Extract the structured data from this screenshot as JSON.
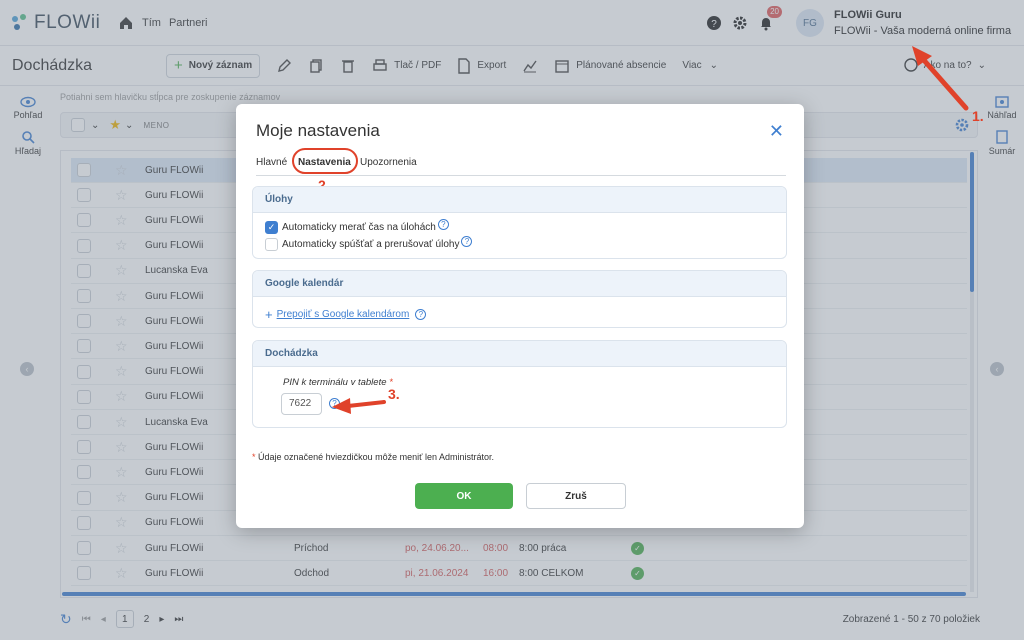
{
  "app": {
    "logo_text": "FLOWii",
    "nav": [
      "Tím",
      "Partneri"
    ],
    "notification_count": "20",
    "avatar_initials": "FG",
    "user_name": "FLOWii Guru",
    "user_firm": "FLOWii - Vaša moderná online firma"
  },
  "toolbar": {
    "title": "Dochádzka",
    "new_record": "Nový záznam",
    "print_pdf": "Tlač / PDF",
    "export": "Export",
    "planned_absences": "Plánované absencie",
    "more": "Viac",
    "how_to": "Ako na to?"
  },
  "side_left": {
    "view": "Pohľad",
    "search": "Hľadaj"
  },
  "side_right": {
    "preview": "Náhľad",
    "summary": "Sumár"
  },
  "grid": {
    "group_hint": "Potiahni sem hlavičku stĺpca pre zoskupenie záznamov",
    "name_header": "MENO",
    "rows": [
      {
        "name": "Guru FLOWii",
        "type": "",
        "date": "",
        "time": "",
        "desc": "",
        "ok": false
      },
      {
        "name": "Guru FLOWii",
        "type": "",
        "date": "",
        "time": "",
        "desc": "",
        "ok": false
      },
      {
        "name": "Guru FLOWii",
        "type": "",
        "date": "",
        "time": "",
        "desc": "",
        "ok": false
      },
      {
        "name": "Guru FLOWii",
        "type": "",
        "date": "",
        "time": "",
        "desc": "",
        "ok": false
      },
      {
        "name": "Lucanska Eva",
        "type": "",
        "date": "",
        "time": "",
        "desc": "",
        "ok": false
      },
      {
        "name": "Guru FLOWii",
        "type": "",
        "date": "",
        "time": "",
        "desc": "",
        "ok": false
      },
      {
        "name": "Guru FLOWii",
        "type": "",
        "date": "",
        "time": "",
        "desc": "",
        "ok": false
      },
      {
        "name": "Guru FLOWii",
        "type": "",
        "date": "",
        "time": "",
        "desc": "",
        "ok": false
      },
      {
        "name": "Guru FLOWii",
        "type": "",
        "date": "",
        "time": "",
        "desc": "",
        "ok": false
      },
      {
        "name": "Guru FLOWii",
        "type": "",
        "date": "",
        "time": "",
        "desc": "",
        "ok": false
      },
      {
        "name": "Lucanska Eva",
        "type": "",
        "date": "",
        "time": "",
        "desc": "",
        "ok": false
      },
      {
        "name": "Guru FLOWii",
        "type": "",
        "date": "",
        "time": "",
        "desc": "",
        "ok": false
      },
      {
        "name": "Guru FLOWii",
        "type": "",
        "date": "",
        "time": "",
        "desc": "",
        "ok": false
      },
      {
        "name": "Guru FLOWii",
        "type": "",
        "date": "",
        "time": "",
        "desc": "",
        "ok": false
      },
      {
        "name": "Guru FLOWii",
        "type": "",
        "date": "",
        "time": "",
        "desc": "",
        "ok": false
      },
      {
        "name": "Guru FLOWii",
        "type": "Príchod",
        "date": "po, 24.06.20...",
        "time": "08:00",
        "desc": "8:00 práca",
        "ok": true
      },
      {
        "name": "Guru FLOWii",
        "type": "Odchod",
        "date": "pi, 21.06.2024",
        "time": "16:00",
        "desc": "8:00 CELKOM",
        "ok": true
      }
    ]
  },
  "pager": {
    "page1": "1",
    "page2": "2",
    "count": "Zobrazené 1 - 50 z 70 položiek"
  },
  "dialog": {
    "title": "Moje nastavenia",
    "tabs": [
      "Hlavné",
      "Nastavenia",
      "Upozornenia"
    ],
    "tasks": {
      "heading": "Úlohy",
      "auto_measure": "Automaticky merať čas na úlohách",
      "auto_start": "Automaticky spúšťať a prerušovať úlohy"
    },
    "gcal": {
      "heading": "Google kalendár",
      "link": "Prepojiť s Google kalendárom"
    },
    "attendance": {
      "heading": "Dochádzka",
      "pin_label": "PIN k terminálu v tablete",
      "pin_value": "7622"
    },
    "note": "Údaje označené hviezdičkou môže meniť len Administrátor.",
    "ok": "OK",
    "cancel": "Zruš"
  },
  "annotations": {
    "step1": "1.",
    "step2": "2.",
    "step3": "3."
  },
  "colors": {
    "accent": "#3f7fd0",
    "ok_green": "#4caf50",
    "annotation_red": "#e0422a"
  }
}
